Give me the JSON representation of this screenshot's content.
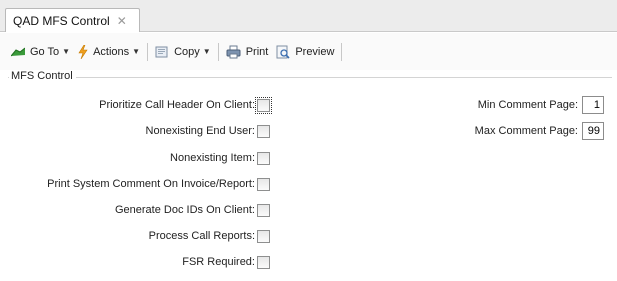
{
  "tab": {
    "title": "QAD MFS Control",
    "close_glyph": "✕"
  },
  "toolbar": {
    "goto_label": "Go To",
    "actions_label": "Actions",
    "copy_label": "Copy",
    "print_label": "Print",
    "preview_label": "Preview"
  },
  "group": {
    "legend": "MFS Control"
  },
  "checkboxes": [
    {
      "label": "Prioritize Call Header On Client:",
      "checked": false
    },
    {
      "label": "Nonexisting End User:",
      "checked": false
    },
    {
      "label": "Nonexisting Item:",
      "checked": false
    },
    {
      "label": "Print System Comment On Invoice/Report:",
      "checked": false
    },
    {
      "label": "Generate Doc IDs On Client:",
      "checked": false
    },
    {
      "label": "Process Call Reports:",
      "checked": false
    },
    {
      "label": "FSR Required:",
      "checked": false
    }
  ],
  "fields": {
    "min_comment_label": "Min Comment Page:",
    "min_comment_value": "1",
    "max_comment_label": "Max Comment Page:",
    "max_comment_value": "99"
  },
  "colors": {
    "accent_green": "#2e8b2e",
    "actions_orange": "#f0a020"
  }
}
